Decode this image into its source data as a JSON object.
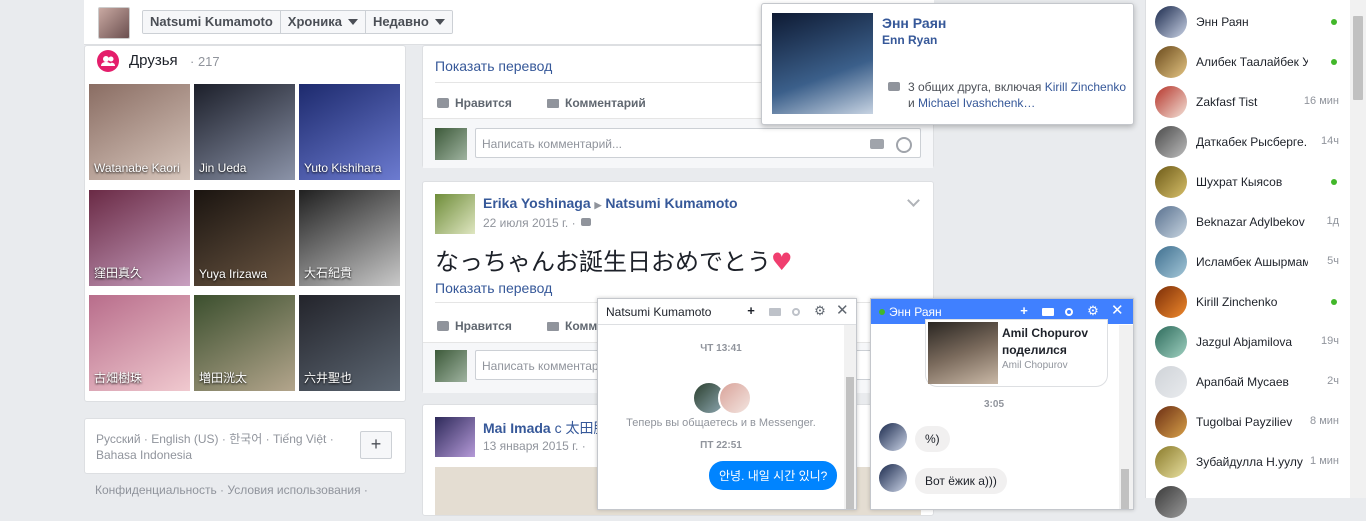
{
  "topbar": {
    "tabs": [
      "Natsumi Kumamoto",
      "Хроника",
      "Недавно"
    ]
  },
  "friends": {
    "title": "Друзья",
    "count": "· 217",
    "items": [
      {
        "name": "Watanabe Kaori",
        "color1": "#8a6d63",
        "color2": "#d8c7bd"
      },
      {
        "name": "Jin Ueda",
        "color1": "#1c1f2a",
        "color2": "#8b93a8"
      },
      {
        "name": "Yuto Kishihara",
        "color1": "#1d2a6d",
        "color2": "#6c7bd0"
      },
      {
        "name": "窪田真久",
        "color1": "#6a2a45",
        "color2": "#c8a0c0"
      },
      {
        "name": "Yuya Irizawa",
        "color1": "#1a1410",
        "color2": "#6b5642"
      },
      {
        "name": "大石紀貴",
        "color1": "#202020",
        "color2": "#c9c9c9"
      },
      {
        "name": "古畑樹珠",
        "color1": "#b86d8b",
        "color2": "#f0c9cf"
      },
      {
        "name": "増田洸太",
        "color1": "#3b4f2e",
        "color2": "#b3a58c"
      },
      {
        "name": "六井聖也",
        "color1": "#23242b",
        "color2": "#5d6773"
      }
    ]
  },
  "languages": {
    "text": "Русский · English (US) · 한국어 · Tiếng Việt · Bahasa Indonesia",
    "plus": "+"
  },
  "footer": "Конфиденциальность · Условия использования ·",
  "post1": {
    "translate": "Показать перевод",
    "like": "Нравится",
    "comment": "Комментарий",
    "comment_placeholder": "Написать комментарий..."
  },
  "post2": {
    "author": "Erika Yoshinaga",
    "arrow": "▶",
    "target": "Natsumi Kumamoto",
    "date": "22 июля 2015 г. ·",
    "text": "なっちゃんお誕生日おめでとう",
    "translate": "Показать перевод",
    "like": "Нравится",
    "comment": "Комм",
    "comment_placeholder": "Написать комментарий..."
  },
  "post3": {
    "author": "Mai Imada",
    "with": "с 太田脇",
    "date": "13 января 2015 г. ·"
  },
  "hovercard": {
    "name": "Энн Раян",
    "alt_name": "Enn Ryan",
    "mutual_prefix": "3 общих друга, включая ",
    "mutual_1": "Kirill Zinchenko",
    "mutual_and": " и ",
    "mutual_2": "Michael Ivashchenk…"
  },
  "sidebar": {
    "contacts": [
      {
        "name": "Энн Раян",
        "time": "",
        "online": true,
        "c1": "#1b2a4d",
        "c2": "#c9d2e5"
      },
      {
        "name": "Алибек Таалайбек У...",
        "time": "",
        "online": true,
        "c1": "#6a4a1c",
        "c2": "#e4c583"
      },
      {
        "name": "Zakfasf Tist",
        "time": "16 мин",
        "online": false,
        "c1": "#b5342a",
        "c2": "#f3e2d8"
      },
      {
        "name": "Даткабек Рысберге...",
        "time": "14ч",
        "online": false,
        "c1": "#4a4a4a",
        "c2": "#bdbdbd"
      },
      {
        "name": "Шухрат Кыясов",
        "time": "",
        "online": true,
        "c1": "#6d5a18",
        "c2": "#d7c06a"
      },
      {
        "name": "Beknazar Adylbekov",
        "time": "1д",
        "online": false,
        "c1": "#59718f",
        "c2": "#c7d4e0"
      },
      {
        "name": "Исламбек Ашырмам...",
        "time": "5ч",
        "online": false,
        "c1": "#3f6f8f",
        "c2": "#a4c7d8"
      },
      {
        "name": "Kirill Zinchenko",
        "time": "",
        "online": true,
        "c1": "#7b2d07",
        "c2": "#f08a2d"
      },
      {
        "name": "Jazgul Abjamilova",
        "time": "19ч",
        "online": false,
        "c1": "#2e6b5c",
        "c2": "#9fd0c0"
      },
      {
        "name": "Арапбай Мусаев",
        "time": "2ч",
        "online": false,
        "c1": "#cfd3d8",
        "c2": "#e9ebee"
      },
      {
        "name": "Tugolbai Payziliev",
        "time": "8 мин",
        "online": false,
        "c1": "#6b2d13",
        "c2": "#d8a24a"
      },
      {
        "name": "Зубайдулла Н.уулу",
        "time": "1 мин",
        "online": false,
        "c1": "#8a7a2a",
        "c2": "#e8e0a0"
      },
      {
        "name": "",
        "time": "",
        "online": false,
        "c1": "#3a3a3a",
        "c2": "#9a9a9a"
      }
    ]
  },
  "chat1": {
    "title": "Natsumi Kumamoto",
    "time1": "ЧТ 13:41",
    "notice": "Теперь вы общаетесь и в Messenger.",
    "time2": "ПТ 22:51",
    "message": "안녕. 내일 시간 있니?"
  },
  "chat2": {
    "title": "Энн Раян",
    "share_name": "Amil Chopurov",
    "share_action": "поделился",
    "share_sub": "Amil Chopurov",
    "time": "3:05",
    "msg1": "%)",
    "msg2": "Вот ёжик а)))"
  },
  "colors": {
    "accent": "#4267b2",
    "link": "#365899",
    "online": "#42b72a",
    "bubble_out": "#0084ff",
    "bubble_in": "#f1f0f0"
  }
}
